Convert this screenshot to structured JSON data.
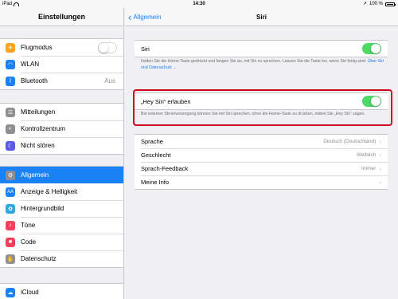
{
  "status_bar": {
    "device": "iPad",
    "time": "14:30",
    "battery_text": "100 %"
  },
  "sidebar": {
    "title": "Einstellungen",
    "groups": [
      [
        {
          "label": "Flugmodus",
          "icon": "airplane-icon",
          "color": "#f7a427",
          "toggle": "off"
        },
        {
          "label": "WLAN",
          "icon": "wifi-icon",
          "color": "#1b82f5"
        },
        {
          "label": "Bluetooth",
          "icon": "bluetooth-icon",
          "color": "#1b82f5",
          "value": "Aus"
        }
      ],
      [
        {
          "label": "Mitteilungen",
          "icon": "notifications-icon",
          "color": "#8e8e93"
        },
        {
          "label": "Kontrollzentrum",
          "icon": "control-center-icon",
          "color": "#8e8e93"
        },
        {
          "label": "Nicht stören",
          "icon": "moon-icon",
          "color": "#5d5ce6"
        }
      ],
      [
        {
          "label": "Allgemein",
          "icon": "gear-icon",
          "color": "#8e8e93",
          "selected": true
        },
        {
          "label": "Anzeige & Helligkeit",
          "icon": "display-icon",
          "color": "#1b82f5"
        },
        {
          "label": "Hintergrundbild",
          "icon": "wallpaper-icon",
          "color": "#31a8e0"
        },
        {
          "label": "Töne",
          "icon": "speaker-icon",
          "color": "#f2405a"
        },
        {
          "label": "Code",
          "icon": "lock-icon",
          "color": "#f2405a"
        },
        {
          "label": "Datenschutz",
          "icon": "hand-icon",
          "color": "#8e8e93"
        }
      ],
      [
        {
          "label": "iCloud",
          "icon": "cloud-icon",
          "color": "#1b82f5"
        }
      ]
    ]
  },
  "nav": {
    "back_label": "Allgemein",
    "title": "Siri"
  },
  "siri": {
    "label": "Siri",
    "toggle": "on",
    "footer": "Halten Sie die Home-Taste gedrückt und fangen Sie an, mit Siri zu sprechen. Lassen Sie die Taste los, wenn Sie fertig sind.",
    "footer_link": "Über Siri und Datenschutz …"
  },
  "hey_siri": {
    "label": "„Hey Siri“ erlauben",
    "toggle": "on",
    "footer": "Bei externer Stromversorgung können Sie mit Siri sprechen, ohne die Home-Taste zu drücken, indem Sie „Hey Siri“ sagen."
  },
  "options": [
    {
      "label": "Sprache",
      "value": "Deutsch (Deutschland)"
    },
    {
      "label": "Geschlecht",
      "value": "Weiblich"
    },
    {
      "label": "Sprach-Feedback",
      "value": "Immer"
    },
    {
      "label": "Meine Info",
      "value": ""
    }
  ],
  "colors": {
    "accent": "#1b7cf5",
    "toggle_on": "#4cd964",
    "highlight": "#d0021b"
  }
}
